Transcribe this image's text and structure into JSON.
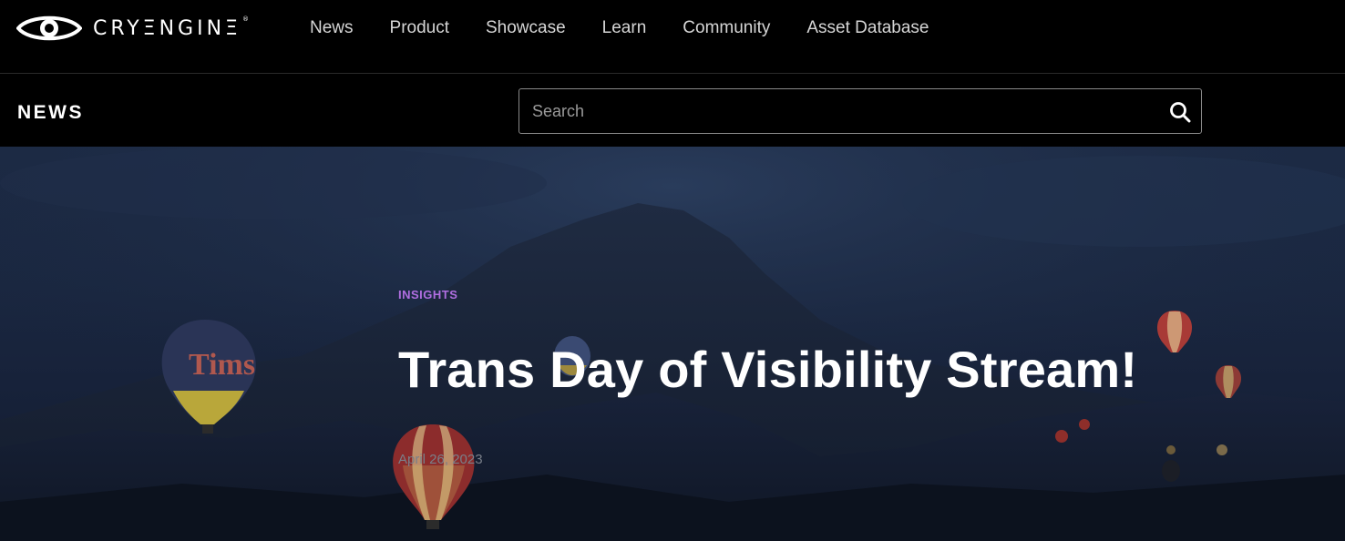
{
  "brand": {
    "name": "CRYΞNGINΞ",
    "registered_mark": "®"
  },
  "nav": {
    "items": [
      {
        "label": "News"
      },
      {
        "label": "Product"
      },
      {
        "label": "Showcase"
      },
      {
        "label": "Learn"
      },
      {
        "label": "Community"
      },
      {
        "label": "Asset Database"
      }
    ]
  },
  "subbar": {
    "title": "NEWS",
    "search": {
      "placeholder": "Search",
      "value": ""
    },
    "search_icon": "search-icon"
  },
  "hero": {
    "category": "INSIGHTS",
    "title": "Trans Day of Visibility Stream!",
    "date": "April 26, 2023",
    "balloon_lettering": "Tims"
  },
  "colors": {
    "background": "#000000",
    "category_accent": "#b06ee0",
    "hero_sky": "#1c2a44"
  }
}
